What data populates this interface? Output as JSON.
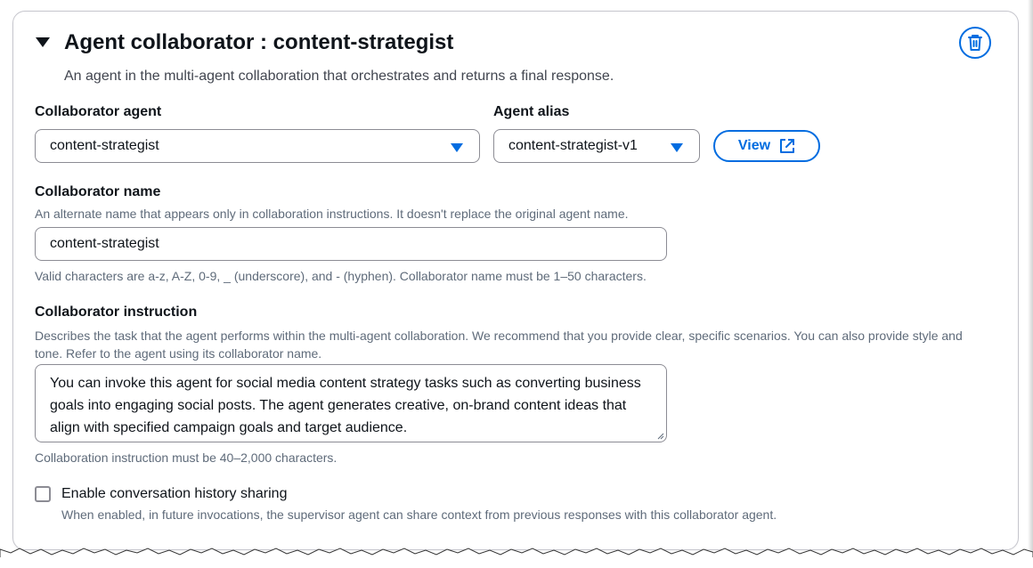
{
  "panel": {
    "title": "Agent collaborator : content-strategist",
    "description": "An agent in the multi-agent collaboration that orchestrates and returns a final response.",
    "delete_icon": "trash-icon",
    "expand_icon": "caret-down-icon"
  },
  "collaborator_agent": {
    "label": "Collaborator agent",
    "value": "content-strategist"
  },
  "agent_alias": {
    "label": "Agent alias",
    "value": "content-strategist-v1",
    "view_label": "View",
    "view_icon": "external-link-icon"
  },
  "collaborator_name": {
    "label": "Collaborator name",
    "hint": "An alternate name that appears only in collaboration instructions. It doesn't replace the original agent name.",
    "value": "content-strategist",
    "constraint": "Valid characters are a-z, A-Z, 0-9, _ (underscore), and - (hyphen). Collaborator name must be 1–50 characters."
  },
  "collaborator_instruction": {
    "label": "Collaborator instruction",
    "hint": "Describes the task that the agent performs within the multi-agent collaboration. We recommend that you provide clear, specific scenarios. You can also provide style and tone. Refer to the agent using its collaborator name.",
    "value": "You can invoke this agent for social media content strategy tasks such as converting business goals into engaging social posts. The agent generates creative, on-brand content ideas that align with specified campaign goals and target audience.",
    "constraint": "Collaboration instruction must be 40–2,000 characters."
  },
  "history_sharing": {
    "label": "Enable conversation history sharing",
    "description": "When enabled, in future invocations, the supervisor agent can share context from previous responses with this collaborator agent.",
    "checked": false
  },
  "colors": {
    "accent": "#006ce0",
    "text": "#0f141a",
    "muted": "#5f6b7a",
    "border": "#8c8c94"
  }
}
